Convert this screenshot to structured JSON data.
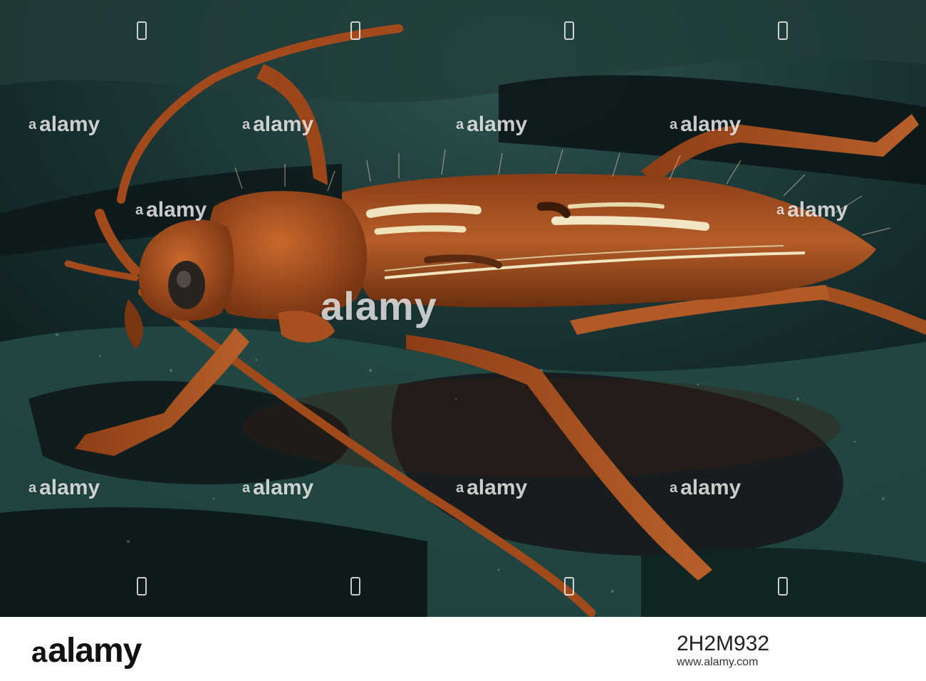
{
  "photo": {
    "alt_subject": "beetle",
    "colors": {
      "background_dark": "#0f1c1d",
      "teal": "#2f6a62",
      "body": "#a8501f",
      "body_dark": "#5a2a10",
      "stripe": "#f2e6c0"
    }
  },
  "watermark": {
    "text": "alamy",
    "repeat_text": "alamy"
  },
  "footer": {
    "logo": "alamy",
    "image_id": "2H2M932",
    "site": "www.alamy.com"
  }
}
